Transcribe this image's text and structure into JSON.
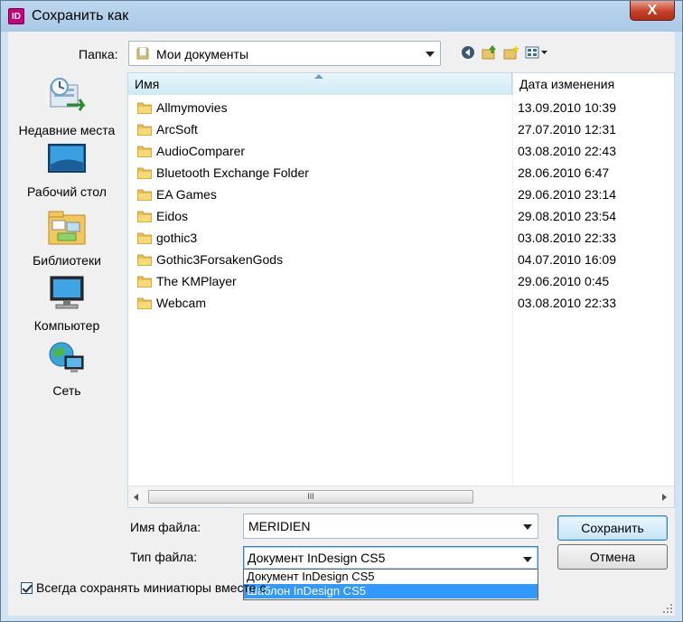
{
  "window": {
    "title": "Сохранить как",
    "app_icon_label": "ID",
    "close_label": "X"
  },
  "folder": {
    "label": "Папка:",
    "value": "Мои документы"
  },
  "toolbar": {
    "icons": [
      "back-icon",
      "up-folder-icon",
      "new-folder-icon",
      "view-menu-icon"
    ]
  },
  "places": [
    {
      "label": "Недавние места",
      "icon": "recent-places-icon"
    },
    {
      "label": "Рабочий стол",
      "icon": "desktop-icon"
    },
    {
      "label": "Библиотеки",
      "icon": "libraries-icon"
    },
    {
      "label": "Компьютер",
      "icon": "computer-icon"
    },
    {
      "label": "Сеть",
      "icon": "network-icon"
    }
  ],
  "list": {
    "columns": {
      "name": "Имя",
      "date": "Дата изменения"
    },
    "rows": [
      {
        "name": "Allmymovies",
        "date": "13.09.2010 10:39"
      },
      {
        "name": "ArcSoft",
        "date": "27.07.2010 12:31"
      },
      {
        "name": "AudioComparer",
        "date": "03.08.2010 22:43"
      },
      {
        "name": "Bluetooth Exchange Folder",
        "date": "28.06.2010 6:47"
      },
      {
        "name": "EA Games",
        "date": "29.06.2010 23:14"
      },
      {
        "name": "Eidos",
        "date": "29.08.2010 23:54"
      },
      {
        "name": "gothic3",
        "date": "03.08.2010 22:33"
      },
      {
        "name": "Gothic3ForsakenGods",
        "date": "04.07.2010 16:09"
      },
      {
        "name": "The KMPlayer",
        "date": "29.06.2010 0:45"
      },
      {
        "name": "Webcam",
        "date": "03.08.2010 22:33"
      }
    ],
    "scroll_thumb_label": "III"
  },
  "filename": {
    "label": "Имя файла:",
    "value": "MERIDIEN"
  },
  "filetype": {
    "label": "Тип файла:",
    "value": "Документ InDesign CS5",
    "options": [
      "Документ InDesign CS5",
      "Шаблон InDesign CS5"
    ]
  },
  "buttons": {
    "save": "Сохранить",
    "cancel": "Отмена"
  },
  "checkbox": {
    "label": "Всегда сохранять миниатюры вместе с",
    "checked": true
  },
  "colors": {
    "accent": "#3399ff",
    "window_frame": "#cfe3f2",
    "close": "#c7412a"
  }
}
